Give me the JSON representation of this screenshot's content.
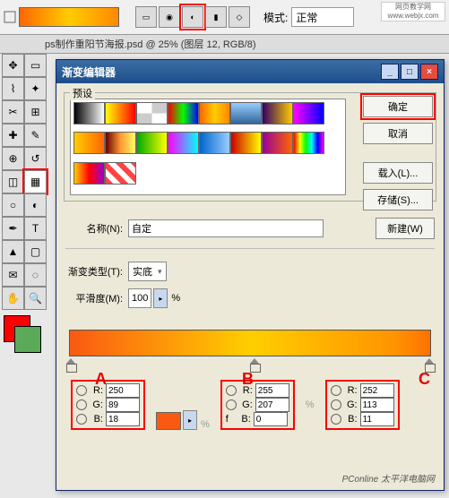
{
  "topbar": {
    "mode_label": "模式:",
    "mode_value": "正常",
    "watermark": "网页教学网\nwww.webjx.com"
  },
  "doc_tab": "ps制作重阳节海报.psd @ 25% (图层 12, RGB/8)",
  "dialog": {
    "title": "渐变编辑器",
    "preset_label": "预设",
    "ok": "确定",
    "cancel": "取消",
    "load": "载入(L)...",
    "save": "存储(S)...",
    "name_label": "名称(N):",
    "name_value": "自定",
    "new_btn": "新建(W)",
    "type_label": "渐变类型(T):",
    "type_value": "实底",
    "smooth_label": "平滑度(M):",
    "smooth_value": "100",
    "percent": "%",
    "labels": {
      "a": "A",
      "b": "B",
      "c": "C"
    },
    "rgb": {
      "r": "R:",
      "g": "G:",
      "b": "B:",
      "a": {
        "r": "250",
        "g": "89",
        "b": "18"
      },
      "b2": {
        "r": "255",
        "g": "207",
        "b": "0"
      },
      "c": {
        "r": "252",
        "g": "113",
        "b": "11"
      }
    },
    "watermark2": "PConline 太平洋电脑网"
  },
  "swatches": [
    "linear-gradient(to right,#000,#fff)",
    "linear-gradient(to right,#ff0,#f00)",
    "repeating-conic-gradient(#ccc 0% 25%,#fff 0% 50%)",
    "linear-gradient(to right,#f00,#0f0,#00f)",
    "linear-gradient(to right,#f60,#fc0,#f80)",
    "linear-gradient(to bottom,#9cf,#369)",
    "linear-gradient(to right,#306,#fc0)",
    "linear-gradient(to right,#f0f,#00f)",
    "linear-gradient(to right,#fc0,#f60)",
    "linear-gradient(to right,#600,#f93,#ff6)",
    "linear-gradient(to right,#0a0,#ff0)",
    "linear-gradient(to right,#f0f,#0ff)",
    "linear-gradient(to right,#06c,#9cf)",
    "linear-gradient(to right,#c00,#ff0)",
    "linear-gradient(to right,#909,#f60)",
    "linear-gradient(to right,#f00,#ff0,#0f0,#0ff,#00f,#f0f)",
    "linear-gradient(to right,#fc0,#f00,#90c)",
    "repeating-linear-gradient(45deg,#f44 0 6px,#fff 6px 12px)"
  ]
}
